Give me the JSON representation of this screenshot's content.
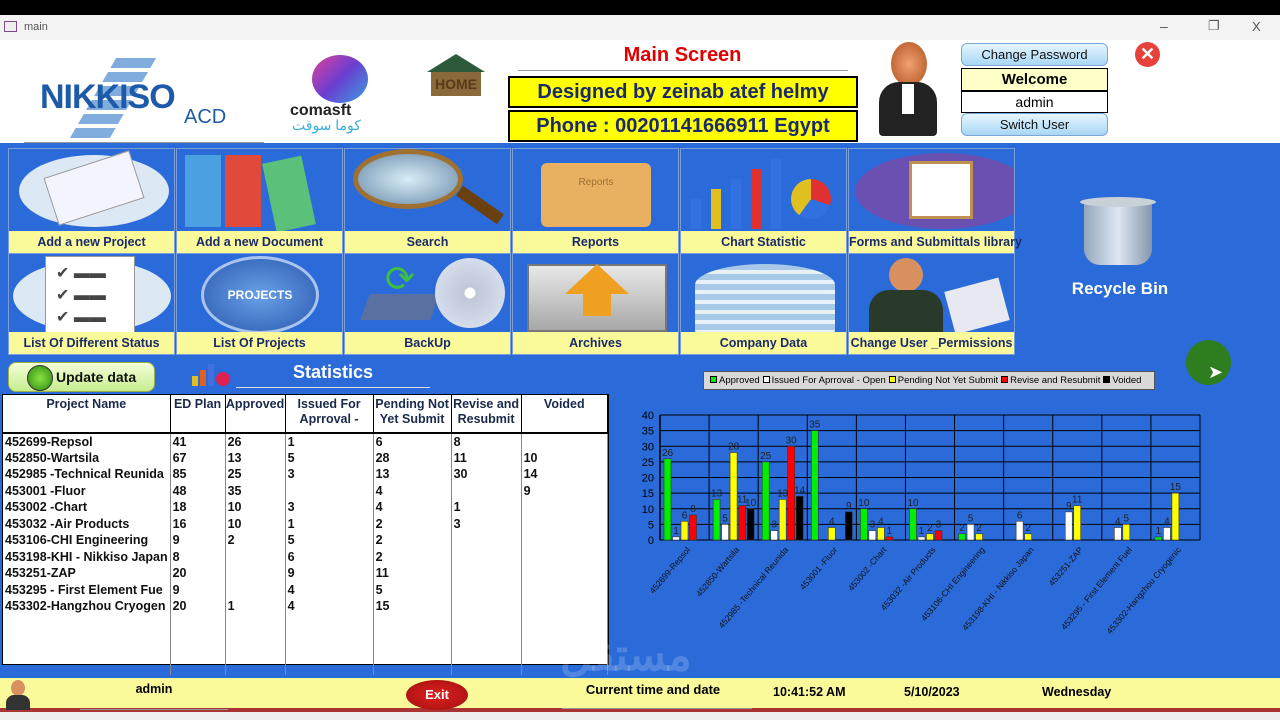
{
  "window": {
    "title": "main",
    "min": "–",
    "max": "❐",
    "close": "X"
  },
  "header": {
    "logo1": {
      "name": "NIKKISO",
      "sub": "ACD"
    },
    "logo2": {
      "name": "comasft",
      "arabic": "كوما سوفت"
    },
    "home_logo": "HOME",
    "main_title": "Main Screen",
    "designed_by": "Designed by zeinab atef helmy",
    "phone": "Phone : 00201141666911 Egypt",
    "change_password": "Change Password",
    "welcome": "Welcome",
    "user": "admin",
    "switch_user": "Switch User"
  },
  "tiles": [
    {
      "label": "Add a new Project",
      "icon": "blueprint-icon"
    },
    {
      "label": "Add a new Document",
      "icon": "binders-icon"
    },
    {
      "label": "Search",
      "icon": "magnifier-icon"
    },
    {
      "label": "Reports",
      "icon": "folder-icon",
      "icon_text": "Reports"
    },
    {
      "label": "Chart Statistic",
      "icon": "bar-chart-icon"
    },
    {
      "label": "Forms and Submittals library",
      "icon": "clipboard-icon"
    },
    {
      "label": "List Of Different Status",
      "icon": "checklist-icon"
    },
    {
      "label": "List Of Projects",
      "icon": "projects-icon",
      "icon_text": "PROJECTS"
    },
    {
      "label": "BackUp",
      "icon": "backup-disk-icon"
    },
    {
      "label": "Archives",
      "icon": "upload-arrow-icon"
    },
    {
      "label": "Company  Data",
      "icon": "building-icon"
    },
    {
      "label": "Change User _Permissions",
      "icon": "user-permissions-icon"
    }
  ],
  "recycle_bin": "Recycle Bin",
  "update_button": "Update data",
  "statistics_title": "Statistics",
  "table": {
    "headers": [
      "Project Name",
      "ED Plan",
      "Approved",
      "Issued For Aprroval -",
      "Pending Not Yet Submit",
      "Revise and Resubmit",
      "Voided"
    ],
    "rows": [
      [
        "452699-Repsol",
        "41",
        "26",
        "1",
        "6",
        "8",
        ""
      ],
      [
        "452850-Wartsila",
        "67",
        "13",
        "5",
        "28",
        "11",
        "10"
      ],
      [
        "452985 -Technical Reunida",
        "85",
        "25",
        "3",
        "13",
        "30",
        "14"
      ],
      [
        "453001 -Fluor",
        "48",
        "35",
        "",
        "4",
        "",
        "9"
      ],
      [
        "453002 -Chart",
        "18",
        "10",
        "3",
        "4",
        "1",
        ""
      ],
      [
        "453032 -Air Products",
        "16",
        "10",
        "1",
        "2",
        "3",
        ""
      ],
      [
        "453106-CHI Engineering",
        "9",
        "2",
        "5",
        "2",
        "",
        ""
      ],
      [
        "453198-KHI - Nikkiso Japan",
        "8",
        "",
        "6",
        "2",
        "",
        ""
      ],
      [
        "453251-ZAP",
        "20",
        "",
        "9",
        "11",
        "",
        ""
      ],
      [
        "453295 - First Element  Fue",
        "9",
        "",
        "4",
        "5",
        "",
        ""
      ],
      [
        "453302-Hangzhou Cryogen",
        "20",
        "1",
        "4",
        "15",
        "",
        ""
      ]
    ]
  },
  "chart_data": {
    "type": "bar",
    "categories": [
      "452699-Repsol",
      "452850-Wartsila",
      "452985 -Technical Reunida",
      "453001 -Fluor",
      "453002 -Chart",
      "453032 -Air Products",
      "453106-CHI Engineering",
      "453198-KHI - Nikkiso Japan",
      "453251-ZAP",
      "453295 - First Element  Fuel",
      "453302-Hangzhou Cryogenic"
    ],
    "series": [
      {
        "name": "Approved",
        "color": "#00ee00",
        "values": [
          26,
          13,
          25,
          35,
          10,
          10,
          2,
          null,
          null,
          null,
          1
        ]
      },
      {
        "name": "Issued For Aprroval - Open",
        "color": "#ffffff",
        "values": [
          1,
          5,
          3,
          null,
          3,
          1,
          5,
          6,
          9,
          4,
          4
        ]
      },
      {
        "name": "Pending Not Yet Submit",
        "color": "#ffff00",
        "values": [
          6,
          28,
          13,
          4,
          4,
          2,
          2,
          2,
          11,
          5,
          15
        ]
      },
      {
        "name": "Revise and Resubmit",
        "color": "#ff0000",
        "values": [
          8,
          11,
          30,
          null,
          1,
          3,
          null,
          null,
          null,
          null,
          null
        ]
      },
      {
        "name": "Voided",
        "color": "#000000",
        "values": [
          null,
          10,
          14,
          9,
          null,
          null,
          null,
          null,
          null,
          null,
          null
        ]
      }
    ],
    "ylim": [
      0,
      40
    ],
    "yticks": [
      0,
      5,
      10,
      15,
      20,
      25,
      30,
      35,
      40
    ],
    "grid": true,
    "legend": "top"
  },
  "footer": {
    "user": "admin",
    "exit": "Exit",
    "time_label": "Current time and date",
    "time": "10:41:52 AM",
    "date": "5/10/2023",
    "day": "Wednesday"
  },
  "watermark": "mostaql.com"
}
